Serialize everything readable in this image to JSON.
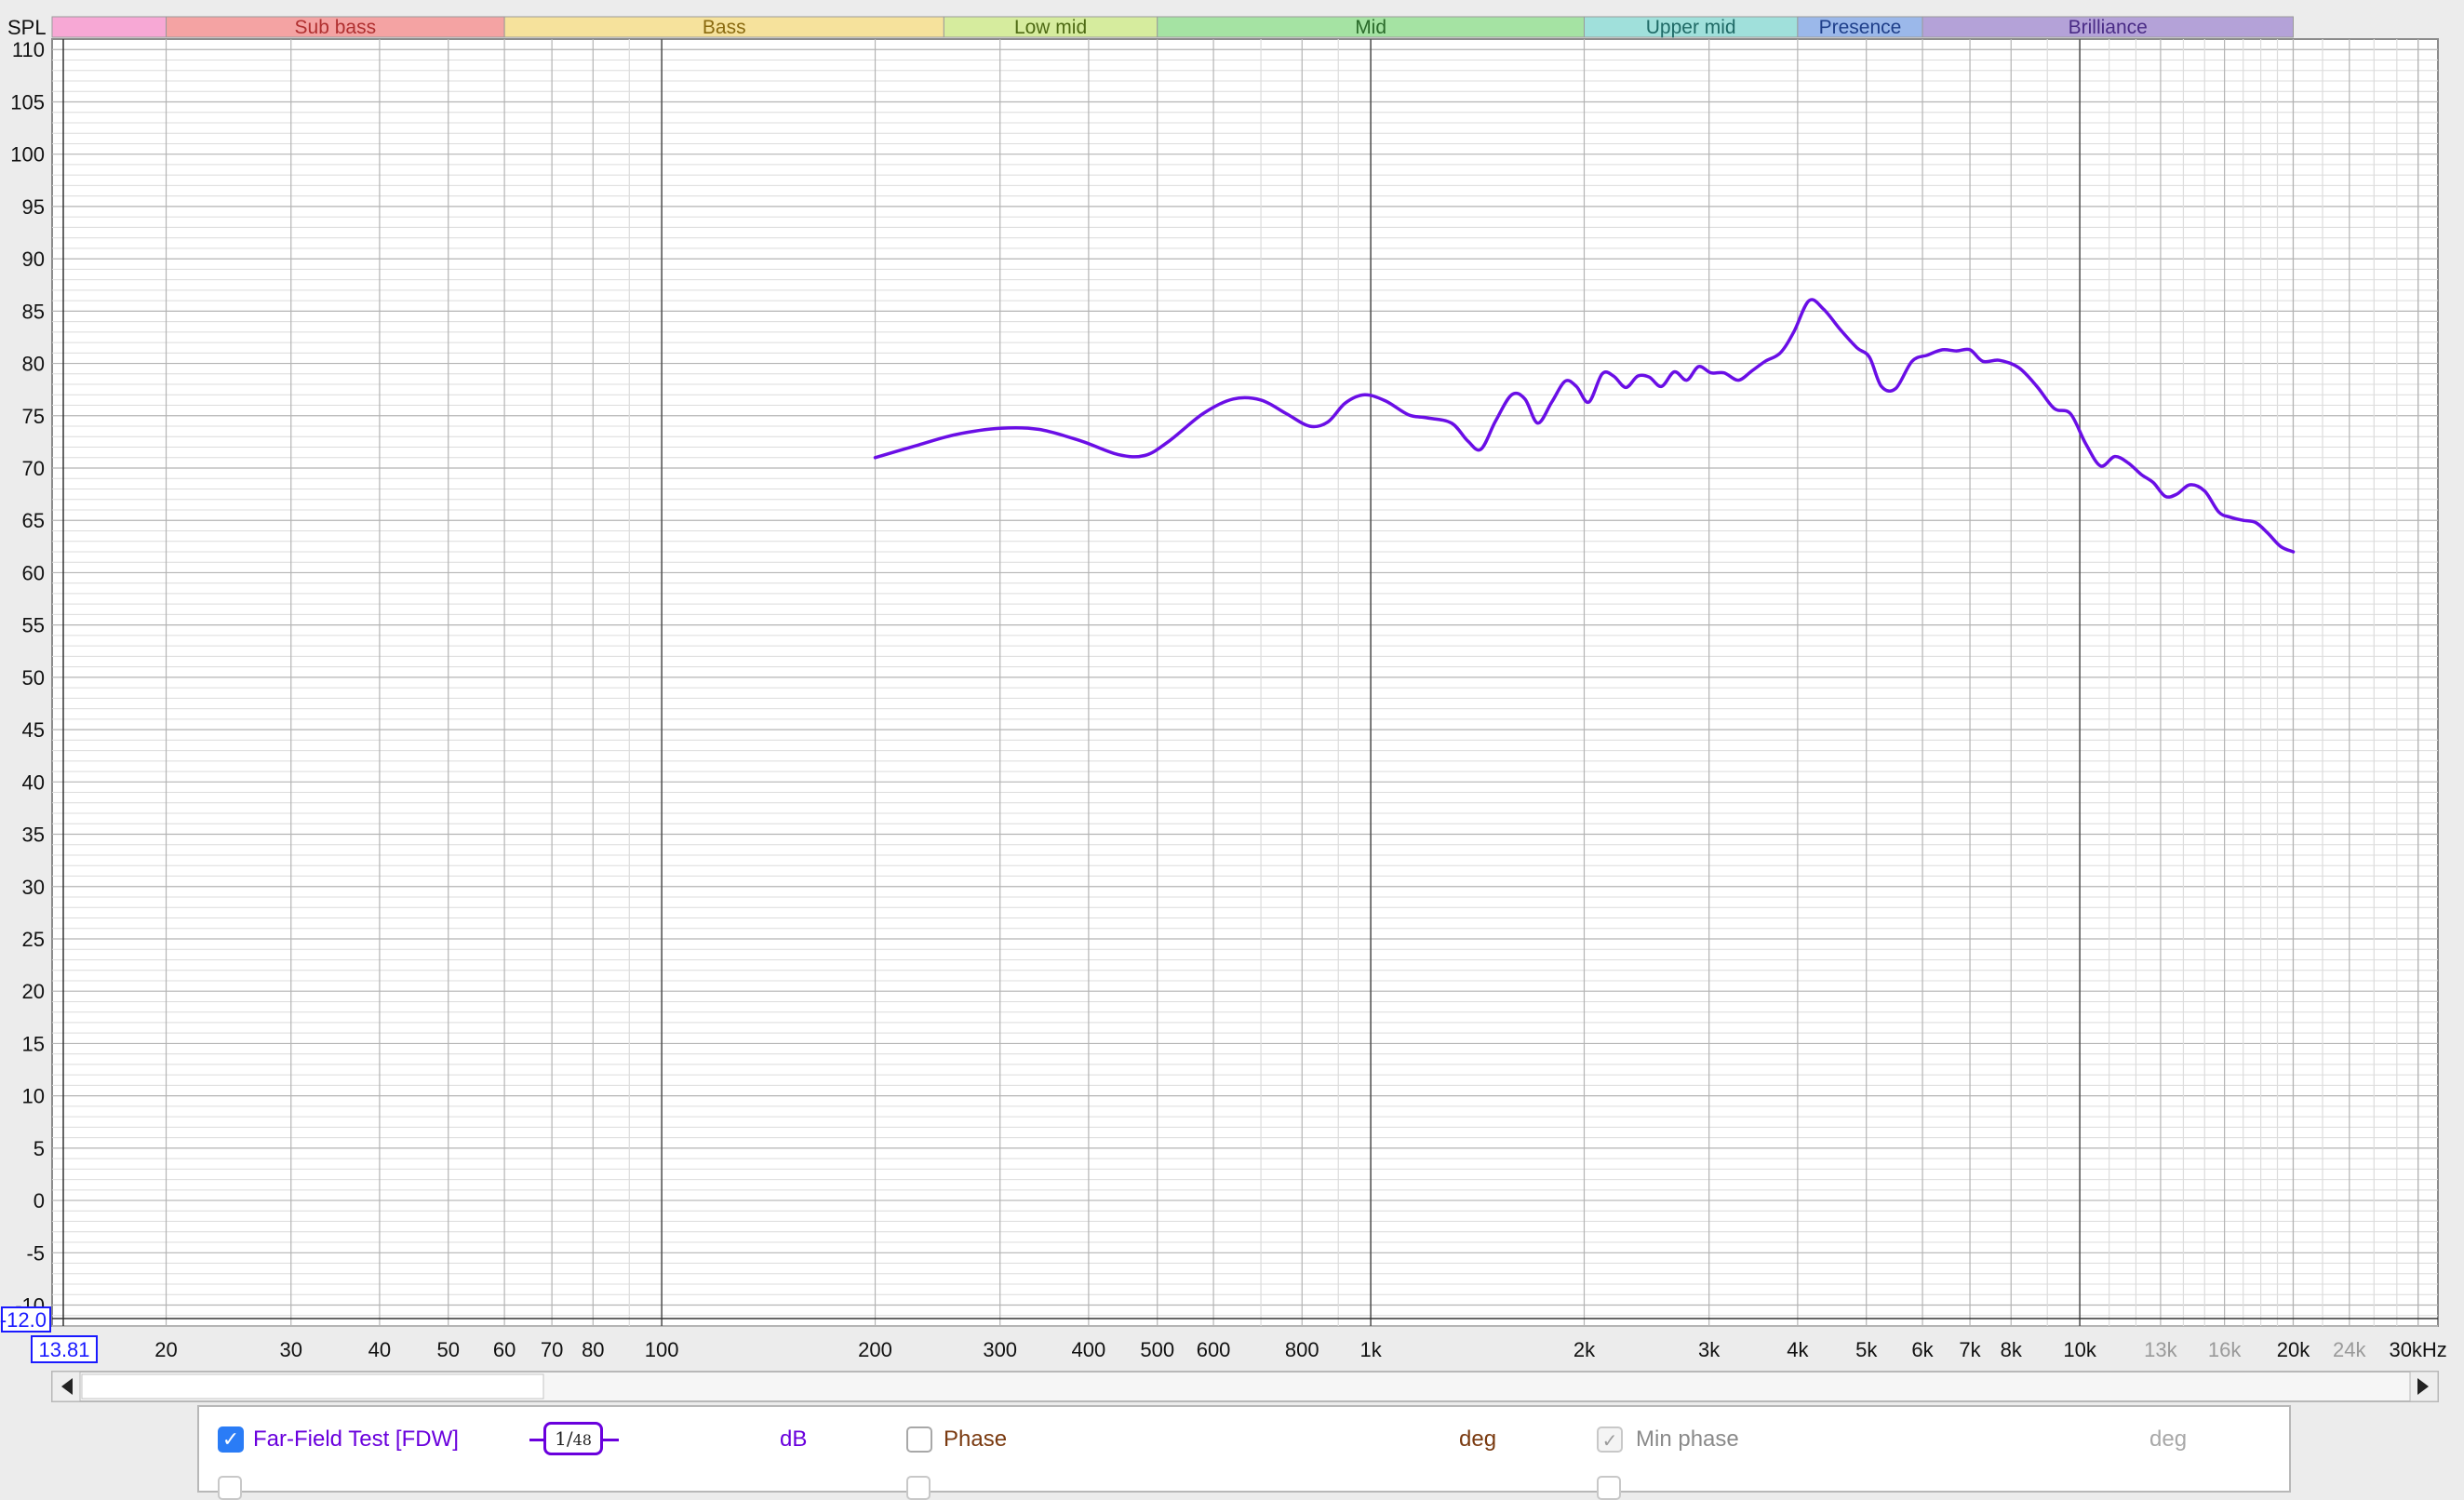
{
  "colors": {
    "curve": "#6a0ee6",
    "grid_major": "#b4b4b4",
    "grid_minor": "#dcdcdc",
    "decade": "#555555",
    "tick_text": "#111111",
    "faint_text": "#9a9a9a",
    "cursor_box": "#1a1aff"
  },
  "header": {
    "spl_label": "SPL"
  },
  "bands": [
    {
      "label": "",
      "start": 13.81,
      "end": 20,
      "color": "#f7a8d5",
      "text_color": "#9a3a6a"
    },
    {
      "label": "Sub bass",
      "start": 20,
      "end": 60,
      "color": "#f4a3a3",
      "text_color": "#b03030"
    },
    {
      "label": "Bass",
      "start": 60,
      "end": 250,
      "color": "#f6e29c",
      "text_color": "#8a6a10"
    },
    {
      "label": "Low mid",
      "start": 250,
      "end": 500,
      "color": "#d6ec9e",
      "text_color": "#4e6a14"
    },
    {
      "label": "Mid",
      "start": 500,
      "end": 2000,
      "color": "#a5e3a3",
      "text_color": "#2a6a2a"
    },
    {
      "label": "Upper mid",
      "start": 2000,
      "end": 4000,
      "color": "#a0e0db",
      "text_color": "#1f6a66"
    },
    {
      "label": "Presence",
      "start": 4000,
      "end": 6000,
      "color": "#9bb8ea",
      "text_color": "#1f3f8a"
    },
    {
      "label": "Brilliance",
      "start": 6000,
      "end": 20000,
      "color": "#b4a2d8",
      "text_color": "#4a2c86"
    }
  ],
  "axis_readouts": {
    "y_cursor": "-12.0",
    "x_cursor": "13.81"
  },
  "panel": {
    "trace_name": "Far-Field Test [FDW]",
    "smoothing_num": "1",
    "smoothing_den": "48",
    "unit_db": "dB",
    "phase_label": "Phase",
    "unit_deg": "deg",
    "min_phase_label": "Min phase",
    "min_phase_check": "✓",
    "unit_deg2": "deg",
    "trace_check": "✓"
  },
  "chart_data": {
    "type": "line",
    "title": "",
    "xlabel": "",
    "ylabel": "SPL",
    "x_scale": "log",
    "xlim": [
      13.81,
      32000
    ],
    "ylim": [
      -12,
      111
    ],
    "grid": true,
    "y_ticks": [
      110,
      105,
      100,
      95,
      90,
      85,
      80,
      75,
      70,
      65,
      60,
      55,
      50,
      45,
      40,
      35,
      30,
      25,
      20,
      15,
      10,
      5,
      0,
      -5,
      -10
    ],
    "x_ticks": [
      {
        "value": 20,
        "label": "20",
        "faint": false
      },
      {
        "value": 30,
        "label": "30",
        "faint": false
      },
      {
        "value": 40,
        "label": "40",
        "faint": false
      },
      {
        "value": 50,
        "label": "50",
        "faint": false
      },
      {
        "value": 60,
        "label": "60",
        "faint": false
      },
      {
        "value": 70,
        "label": "70",
        "faint": false
      },
      {
        "value": 80,
        "label": "80",
        "faint": false
      },
      {
        "value": 100,
        "label": "100",
        "faint": false
      },
      {
        "value": 200,
        "label": "200",
        "faint": false
      },
      {
        "value": 300,
        "label": "300",
        "faint": false
      },
      {
        "value": 400,
        "label": "400",
        "faint": false
      },
      {
        "value": 500,
        "label": "500",
        "faint": false
      },
      {
        "value": 600,
        "label": "600",
        "faint": false
      },
      {
        "value": 800,
        "label": "800",
        "faint": false
      },
      {
        "value": 1000,
        "label": "1k",
        "faint": false
      },
      {
        "value": 2000,
        "label": "2k",
        "faint": false
      },
      {
        "value": 3000,
        "label": "3k",
        "faint": false
      },
      {
        "value": 4000,
        "label": "4k",
        "faint": false
      },
      {
        "value": 5000,
        "label": "5k",
        "faint": false
      },
      {
        "value": 6000,
        "label": "6k",
        "faint": false
      },
      {
        "value": 7000,
        "label": "7k",
        "faint": false
      },
      {
        "value": 8000,
        "label": "8k",
        "faint": false
      },
      {
        "value": 10000,
        "label": "10k",
        "faint": false
      },
      {
        "value": 13000,
        "label": "13k",
        "faint": true
      },
      {
        "value": 16000,
        "label": "16k",
        "faint": true
      },
      {
        "value": 20000,
        "label": "20k",
        "faint": false
      },
      {
        "value": 24000,
        "label": "24k",
        "faint": true
      },
      {
        "value": 30000,
        "label": "30kHz",
        "faint": false
      }
    ],
    "series": [
      {
        "name": "Far-Field Test [FDW]",
        "color": "#6a0ee6",
        "x": [
          200,
          230,
          260,
          300,
          340,
          390,
          440,
          480,
          520,
          580,
          640,
          700,
          760,
          820,
          870,
          920,
          980,
          1050,
          1130,
          1200,
          1300,
          1370,
          1430,
          1500,
          1580,
          1650,
          1720,
          1800,
          1880,
          1950,
          2030,
          2120,
          2200,
          2290,
          2380,
          2470,
          2570,
          2680,
          2790,
          2900,
          3020,
          3150,
          3300,
          3450,
          3600,
          3780,
          3950,
          4150,
          4350,
          4600,
          4850,
          5050,
          5250,
          5500,
          5800,
          6100,
          6400,
          6700,
          7000,
          7300,
          7700,
          8200,
          8700,
          9200,
          9700,
          10200,
          10700,
          11200,
          11700,
          12200,
          12700,
          13200,
          13700,
          14300,
          15000,
          15700,
          16300,
          17000,
          17700,
          18400,
          19200,
          20000
        ],
        "values": [
          71,
          72.2,
          73.2,
          73.8,
          73.7,
          72.6,
          71.3,
          71.2,
          72.6,
          75.2,
          76.6,
          76.5,
          75.2,
          74,
          74.4,
          76.2,
          77,
          76.4,
          75.1,
          74.8,
          74.3,
          72.6,
          71.8,
          74.5,
          77,
          76.6,
          74.3,
          76.3,
          78.3,
          77.8,
          76.3,
          79,
          78.8,
          77.7,
          78.8,
          78.7,
          77.8,
          79.2,
          78.4,
          79.7,
          79.1,
          79.1,
          78.4,
          79.3,
          80.2,
          81,
          83,
          86,
          85.2,
          83.2,
          81.5,
          80.6,
          77.8,
          77.6,
          80.2,
          80.8,
          81.3,
          81.2,
          81.3,
          80.2,
          80.3,
          79.6,
          77.8,
          75.7,
          75.2,
          72.3,
          70.2,
          71.1,
          70.5,
          69.4,
          68.6,
          67.3,
          67.5,
          68.4,
          67.8,
          65.8,
          65.3,
          65,
          64.8,
          63.8,
          62.5,
          62
        ]
      }
    ]
  }
}
